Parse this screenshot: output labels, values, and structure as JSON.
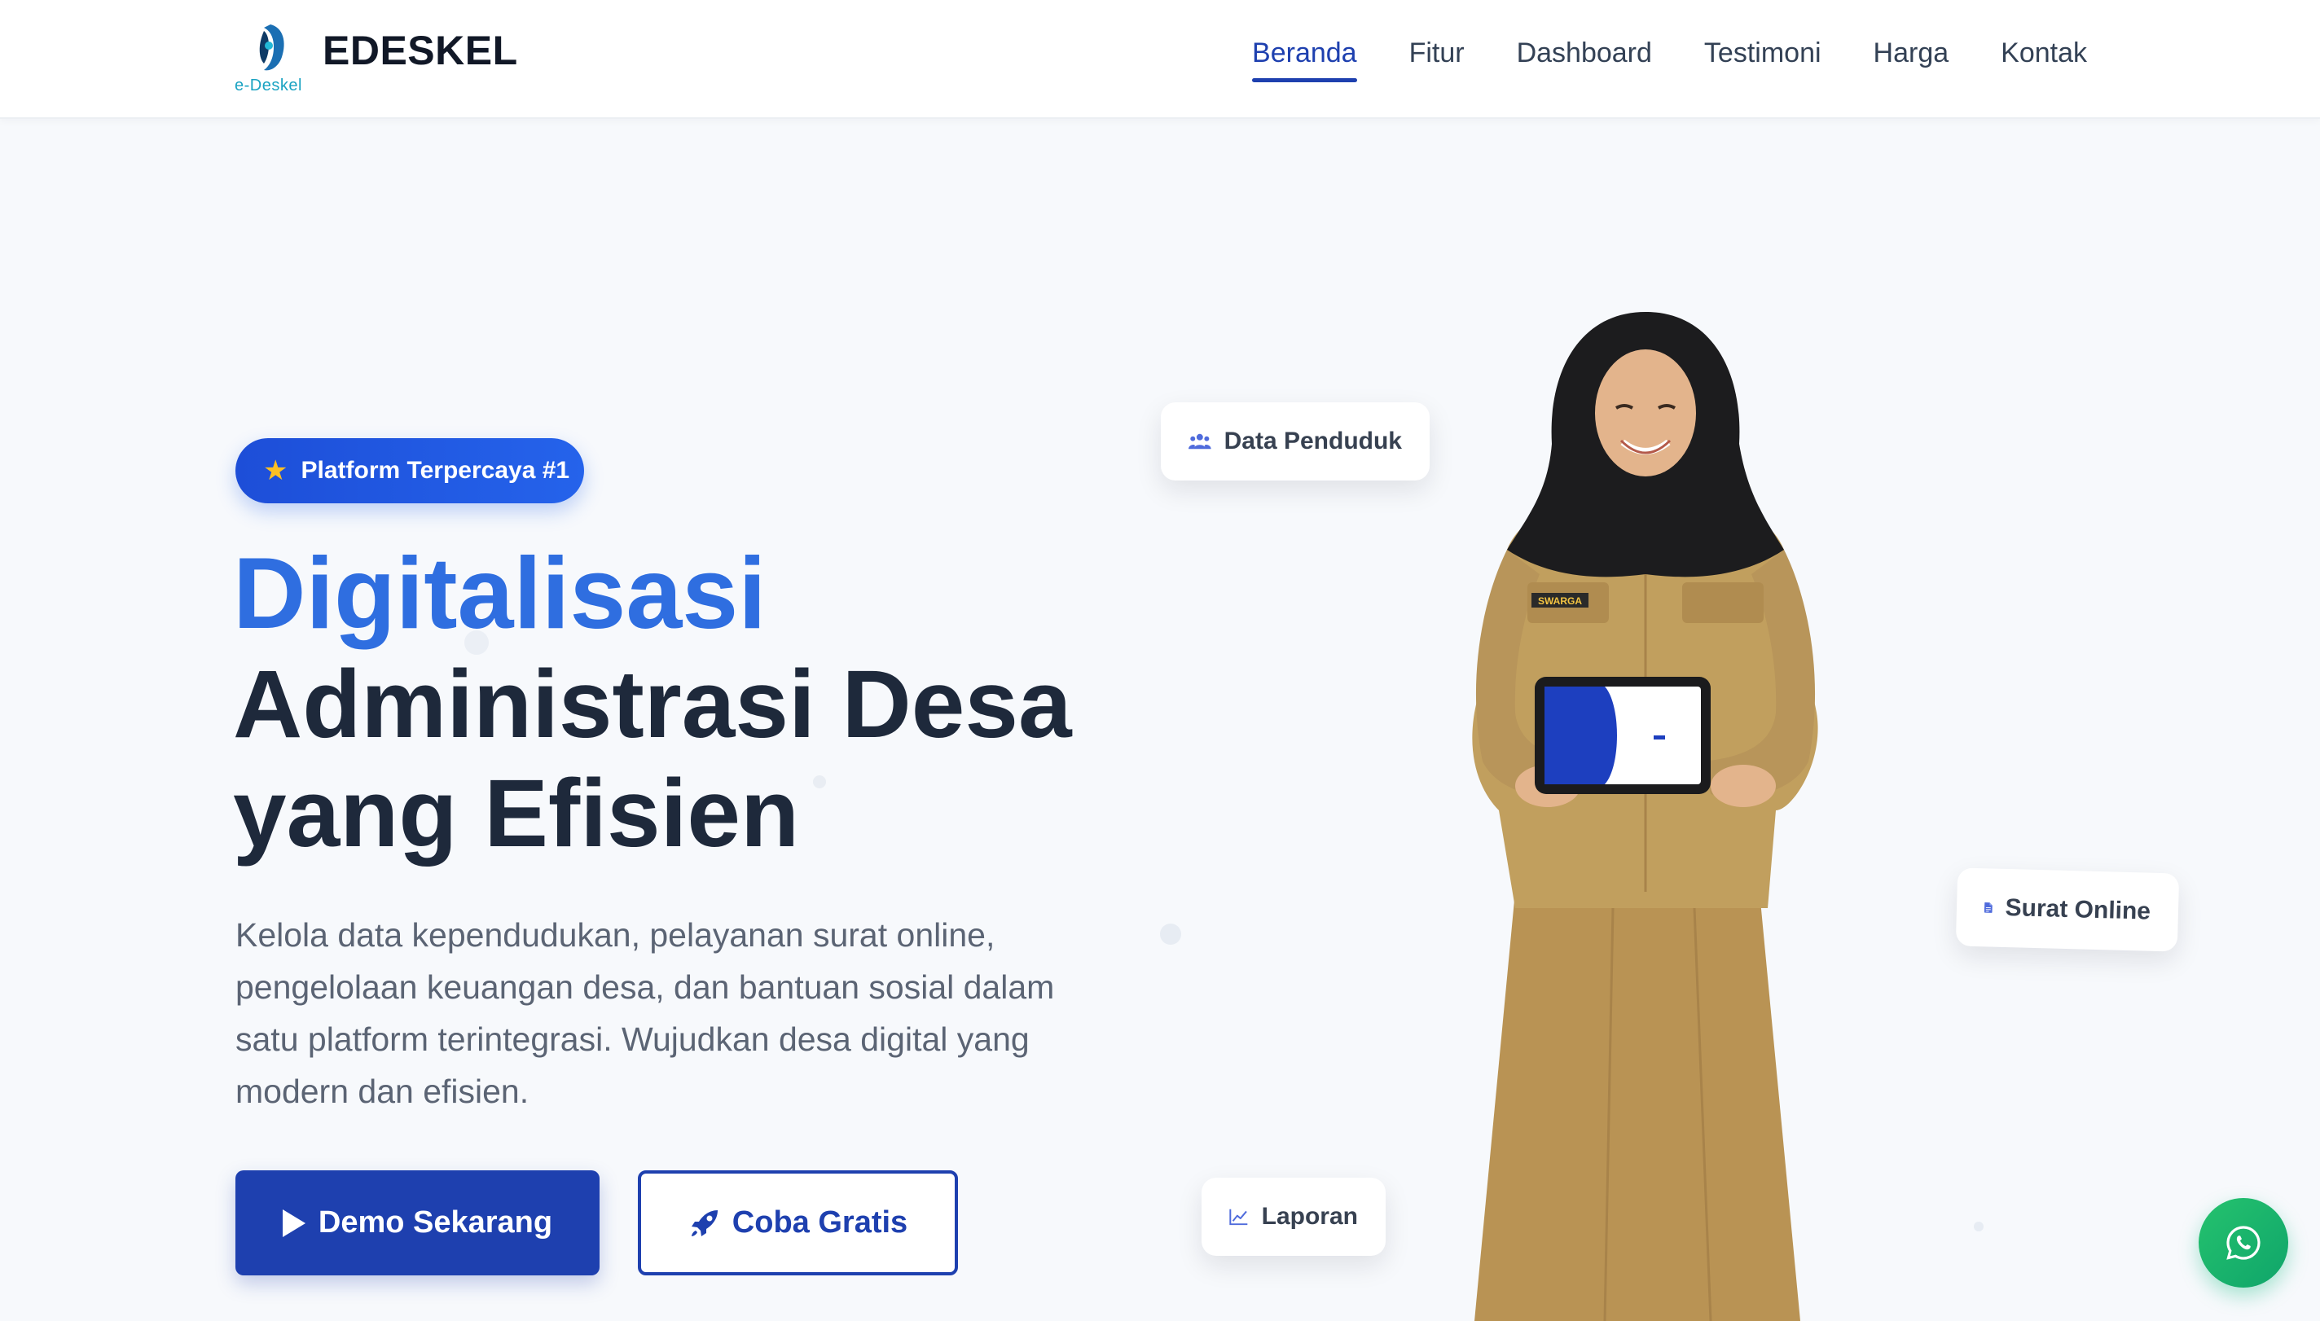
{
  "brand": {
    "name": "EDESKEL",
    "logo_subtext": "e-Deskel"
  },
  "nav": {
    "items": [
      {
        "label": "Beranda",
        "active": true
      },
      {
        "label": "Fitur",
        "active": false
      },
      {
        "label": "Dashboard",
        "active": false
      },
      {
        "label": "Testimoni",
        "active": false
      },
      {
        "label": "Harga",
        "active": false
      },
      {
        "label": "Kontak",
        "active": false
      }
    ]
  },
  "hero": {
    "badge": {
      "icon": "star-icon",
      "label": "Platform Terpercaya #1"
    },
    "title_line1": "Digitalisasi",
    "title_line2": "Administrasi Desa",
    "title_line3": "yang Efisien",
    "description": "Kelola data kependudukan, pelayanan surat online, pengelolaan keuangan desa, dan bantuan sosial dalam satu platform terintegrasi. Wujudkan desa digital yang modern dan efisien.",
    "primary_button": {
      "icon": "play-icon",
      "label": "Demo Sekarang"
    },
    "secondary_button": {
      "icon": "rocket-icon",
      "label": "Coba Gratis"
    }
  },
  "floating_cards": {
    "population": {
      "icon": "users-icon",
      "label": "Data Penduduk"
    },
    "letters": {
      "icon": "document-icon",
      "label": "Surat Online"
    },
    "reports": {
      "icon": "chart-line-icon",
      "label": "Laporan"
    }
  },
  "person": {
    "name_tag": "SWARGA"
  },
  "colors": {
    "primary": "#1e40af",
    "accent_blue": "#2f6ee0",
    "heading": "#1e293b",
    "body_text": "#5b6474",
    "badge_star": "#fbbf24",
    "whatsapp": "#25c26e",
    "uniform": "#b8965a"
  },
  "whatsapp": {
    "icon": "whatsapp-icon"
  }
}
